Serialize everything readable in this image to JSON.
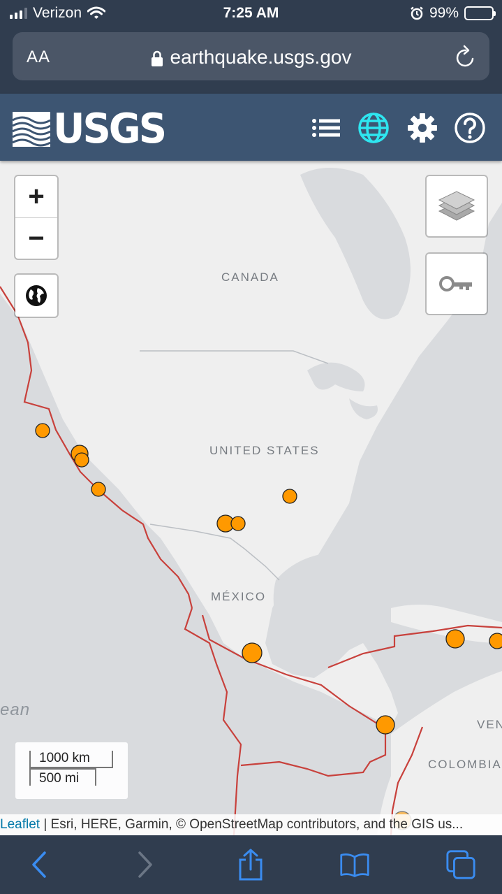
{
  "status_bar": {
    "carrier": "Verizon",
    "time": "7:25 AM",
    "battery_percent": "99%",
    "battery_level": 0.99,
    "icons": [
      "signal-bars-icon",
      "wifi-icon",
      "alarm-icon",
      "battery-charging-icon"
    ]
  },
  "browser": {
    "text_size_label": "AA",
    "url": "earthquake.usgs.gov",
    "icons": [
      "lock-icon",
      "reload-icon"
    ]
  },
  "header": {
    "logo_text": "USGS",
    "icons": [
      "list-icon",
      "globe-icon",
      "gear-icon",
      "help-icon"
    ],
    "colors": {
      "background": "#3d5572",
      "active_icon": "#2ee6f0"
    }
  },
  "map": {
    "labels": {
      "canada": "CANADA",
      "united_states": "UNITED STATES",
      "mexico": "MÉXICO",
      "colombia": "COLOMBIA",
      "venezuela_partial": "VEN",
      "ocean_partial": "ean"
    },
    "controls": {
      "zoom_in": "+",
      "zoom_out": "−",
      "icons": [
        "zoom-in-icon",
        "zoom-out-icon",
        "globe-icon",
        "layers-icon",
        "key-icon"
      ]
    },
    "scale": {
      "km": "1000 km",
      "mi": "500 mi"
    },
    "attribution": {
      "leaflet": "Leaflet",
      "rest": " | Esri, HERE, Garmin, © OpenStreetMap contributors, and the GIS us..."
    },
    "colors": {
      "earthquake_marker": "#ff9900",
      "plate_boundary": "#c8413c",
      "land": "#efefef",
      "water": "#d9dbde"
    }
  },
  "toolbar": {
    "icons": [
      "back-icon",
      "forward-icon",
      "share-icon",
      "bookmarks-icon",
      "tabs-icon"
    ],
    "colors": {
      "active": "#3a8cf0",
      "disabled": "#6b7685"
    }
  }
}
